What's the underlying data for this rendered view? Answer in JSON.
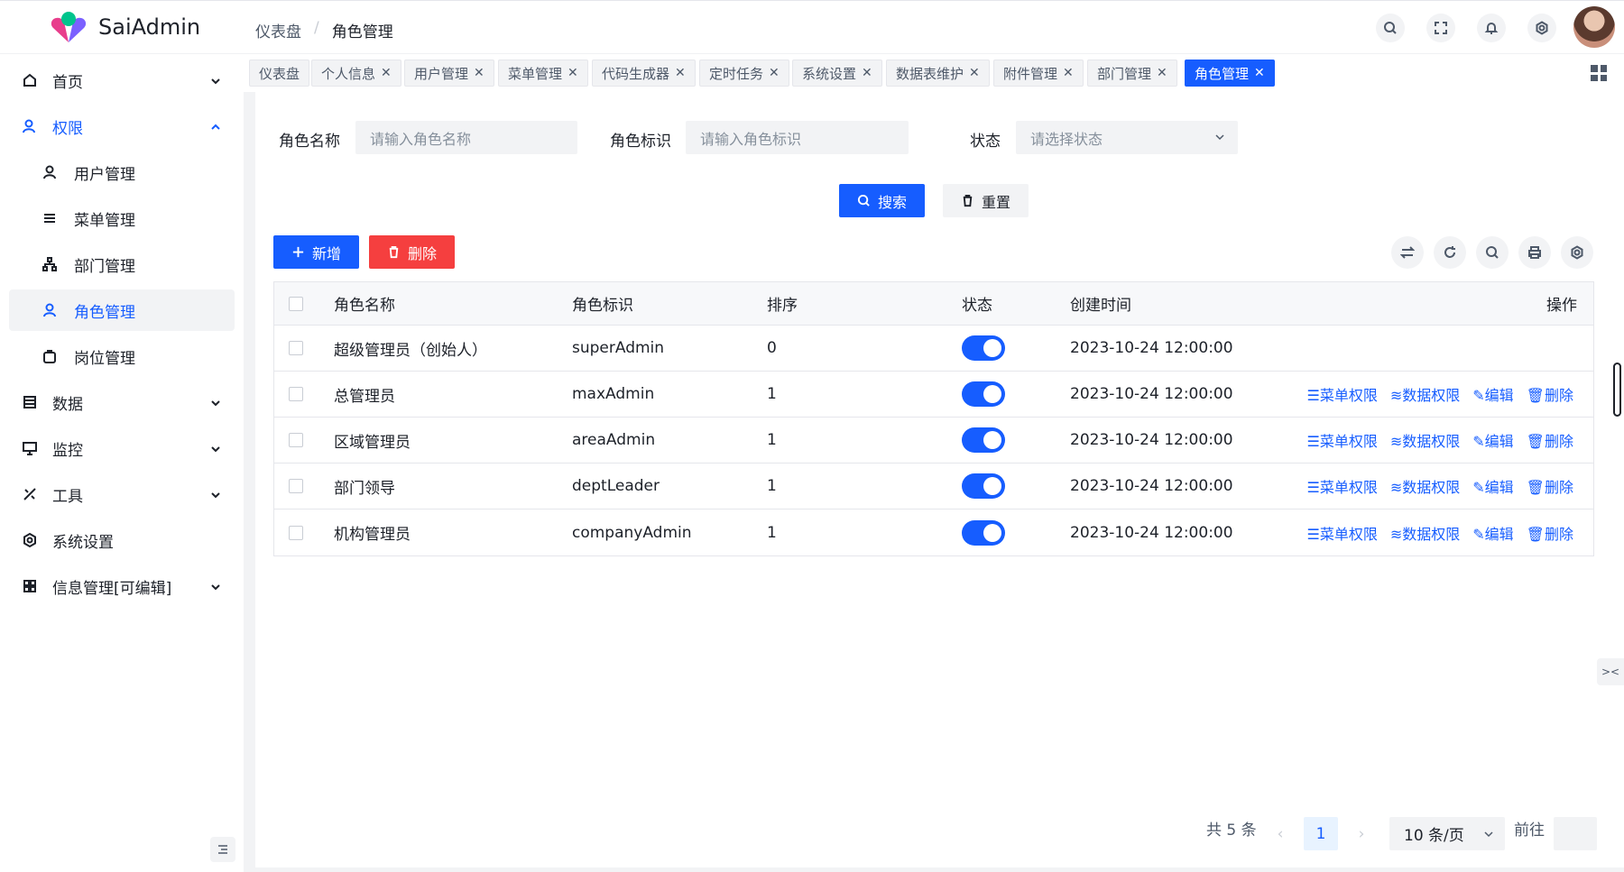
{
  "app": {
    "brand": "SaiAdmin"
  },
  "breadcrumb": [
    "仪表盘",
    "/",
    "角色管理"
  ],
  "sidebar": {
    "items": [
      {
        "label": "首页",
        "icon": "home-icon"
      },
      {
        "label": "权限",
        "icon": "user-lock-icon"
      },
      {
        "label": "用户管理",
        "icon": "user-icon"
      },
      {
        "label": "菜单管理",
        "icon": "list-icon"
      },
      {
        "label": "部门管理",
        "icon": "org-chart-icon"
      },
      {
        "label": "角色管理",
        "icon": "role-icon"
      },
      {
        "label": "岗位管理",
        "icon": "post-icon"
      },
      {
        "label": "数据",
        "icon": "database-icon"
      },
      {
        "label": "监控",
        "icon": "monitor-icon"
      },
      {
        "label": "工具",
        "icon": "tool-icon"
      },
      {
        "label": "系统设置",
        "icon": "gear-icon"
      },
      {
        "label": "信息管理[可编辑]",
        "icon": "grid-icon"
      }
    ]
  },
  "tabs": [
    "仪表盘",
    "个人信息",
    "用户管理",
    "菜单管理",
    "代码生成器",
    "定时任务",
    "系统设置",
    "数据表维护",
    "附件管理",
    "部门管理",
    "角色管理"
  ],
  "search": {
    "role_name_label": "角色名称",
    "role_name_placeholder": "请输入角色名称",
    "role_code_label": "角色标识",
    "role_code_placeholder": "请输入角色标识",
    "status_label": "状态",
    "status_placeholder": "请选择状态",
    "search_btn": "搜索",
    "reset_btn": "重置"
  },
  "toolbar": {
    "add": "新增",
    "delete": "删除"
  },
  "table": {
    "columns": [
      "角色名称",
      "角色标识",
      "排序",
      "状态",
      "创建时间",
      "操作"
    ],
    "rows": [
      {
        "name": "超级管理员（创始人）",
        "code": "superAdmin",
        "sort": "0",
        "status": true,
        "created": "2023-10-24 12:00:00",
        "ops": false
      },
      {
        "name": "总管理员",
        "code": "maxAdmin",
        "sort": "1",
        "status": true,
        "created": "2023-10-24 12:00:00",
        "ops": true
      },
      {
        "name": "区域管理员",
        "code": "areaAdmin",
        "sort": "1",
        "status": true,
        "created": "2023-10-24 12:00:00",
        "ops": true
      },
      {
        "name": "部门领导",
        "code": "deptLeader",
        "sort": "1",
        "status": true,
        "created": "2023-10-24 12:00:00",
        "ops": true
      },
      {
        "name": "机构管理员",
        "code": "companyAdmin",
        "sort": "1",
        "status": true,
        "created": "2023-10-24 12:00:00",
        "ops": true
      }
    ],
    "ops_labels": {
      "menu_perm": "☰菜单权限",
      "data_perm": "≋数据权限",
      "edit": "✎编辑",
      "delete": "🗑删除"
    }
  },
  "pagination": {
    "total": "共 5 条",
    "current": "1",
    "page_size": "10 条/页",
    "goto": "前往"
  },
  "colors": {
    "primary": "#165dff",
    "danger": "#f53f3f"
  }
}
